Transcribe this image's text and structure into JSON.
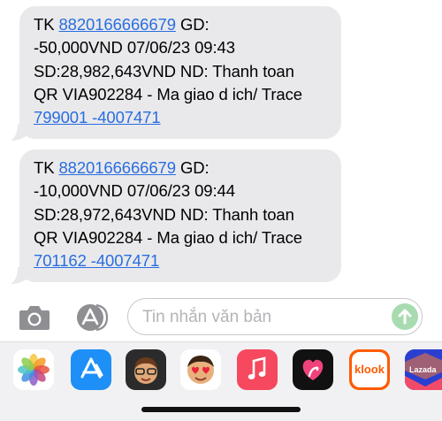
{
  "messages": [
    {
      "prefix": "TK ",
      "account_link": "8820166666679",
      "suffix": " GD:",
      "line2": "-50,000VND 07/06/23 09:43",
      "line3": "SD:28,982,643VND ND: Thanh toan",
      "line4": "QR VIA902284 - Ma giao d ich/ Trace",
      "trace_link": "799001 -4007471"
    },
    {
      "prefix": "TK ",
      "account_link": "8820166666679",
      "suffix": " GD:",
      "line2": "-10,000VND 07/06/23 09:44",
      "line3": "SD:28,972,643VND ND: Thanh toan",
      "line4": "QR VIA902284 - Ma giao d ich/ Trace",
      "trace_link": "701162 -4007471"
    }
  ],
  "composer": {
    "placeholder": "Tin nhắn văn bản",
    "camera_icon": "camera-icon",
    "apps_icon": "app-store-icon",
    "send_icon": "send-arrow-icon"
  },
  "app_drawer": {
    "apps": [
      {
        "name": "Photos",
        "icon": "photos-icon"
      },
      {
        "name": "App Store",
        "icon": "app-store-icon"
      },
      {
        "name": "Memoji",
        "icon": "memoji-icon"
      },
      {
        "name": "Memoji Stickers",
        "icon": "memoji-stickers-icon"
      },
      {
        "name": "Music",
        "icon": "music-icon"
      },
      {
        "name": "Digital Touch",
        "icon": "digital-touch-icon"
      },
      {
        "name": "klook",
        "label": "klook",
        "icon": "klook-icon"
      },
      {
        "name": "Lazada",
        "label": "Lazada",
        "icon": "lazada-icon"
      }
    ]
  },
  "colors": {
    "bubble": "#e9e9eb",
    "link": "#2a6ee0",
    "send_disabled": "#a8dcb0",
    "drawer": "#f1f1f3"
  }
}
